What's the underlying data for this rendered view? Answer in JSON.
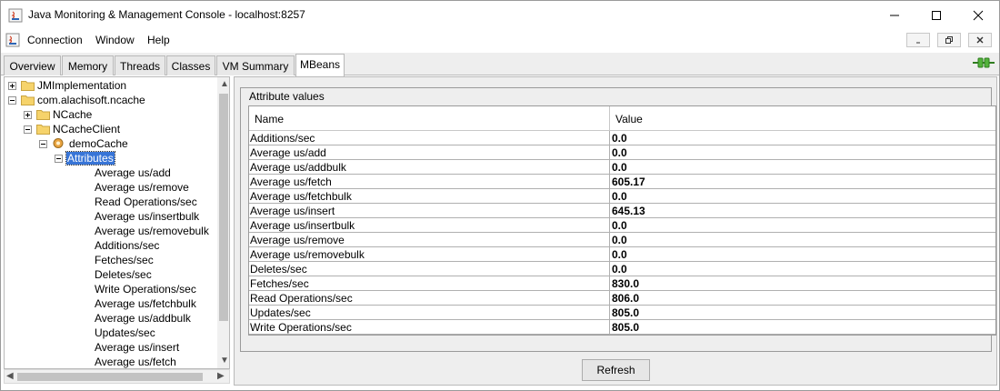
{
  "window": {
    "title": "Java Monitoring & Management Console - localhost:8257"
  },
  "menu": {
    "items": [
      "Connection",
      "Window",
      "Help"
    ]
  },
  "tabs": [
    {
      "label": "Overview"
    },
    {
      "label": "Memory"
    },
    {
      "label": "Threads"
    },
    {
      "label": "Classes"
    },
    {
      "label": "VM Summary"
    },
    {
      "label": "MBeans",
      "active": true
    }
  ],
  "tree": {
    "nodes": [
      {
        "label": "JMImplementation",
        "expander": "plus",
        "type": "folder"
      },
      {
        "label": "com.alachisoft.ncache",
        "expander": "minus",
        "type": "folder"
      },
      {
        "label": "NCache",
        "expander": "plus",
        "type": "folder"
      },
      {
        "label": "NCacheClient",
        "expander": "minus",
        "type": "folder"
      },
      {
        "label": "demoCache",
        "expander": "minus",
        "type": "bean"
      },
      {
        "label": "Attributes",
        "expander": "minus",
        "type": "none",
        "selected": true
      },
      {
        "label": "Average us/add"
      },
      {
        "label": "Average us/remove"
      },
      {
        "label": "Read Operations/sec"
      },
      {
        "label": "Average us/insertbulk"
      },
      {
        "label": "Average us/removebulk"
      },
      {
        "label": "Additions/sec"
      },
      {
        "label": "Fetches/sec"
      },
      {
        "label": "Deletes/sec"
      },
      {
        "label": "Write Operations/sec"
      },
      {
        "label": "Average us/fetchbulk"
      },
      {
        "label": "Average us/addbulk"
      },
      {
        "label": "Updates/sec"
      },
      {
        "label": "Average us/insert"
      },
      {
        "label": "Average us/fetch"
      }
    ]
  },
  "attributes": {
    "group_title": "Attribute values",
    "columns": {
      "name": "Name",
      "value": "Value"
    },
    "rows": [
      {
        "name": "Additions/sec",
        "value": "0.0"
      },
      {
        "name": "Average us/add",
        "value": "0.0"
      },
      {
        "name": "Average us/addbulk",
        "value": "0.0"
      },
      {
        "name": "Average us/fetch",
        "value": "605.17"
      },
      {
        "name": "Average us/fetchbulk",
        "value": "0.0"
      },
      {
        "name": "Average us/insert",
        "value": "645.13"
      },
      {
        "name": "Average us/insertbulk",
        "value": "0.0"
      },
      {
        "name": "Average us/remove",
        "value": "0.0"
      },
      {
        "name": "Average us/removebulk",
        "value": "0.0"
      },
      {
        "name": "Deletes/sec",
        "value": "0.0"
      },
      {
        "name": "Fetches/sec",
        "value": "830.0"
      },
      {
        "name": "Read Operations/sec",
        "value": "806.0"
      },
      {
        "name": "Updates/sec",
        "value": "805.0"
      },
      {
        "name": "Write Operations/sec",
        "value": "805.0"
      }
    ],
    "refresh_label": "Refresh"
  }
}
